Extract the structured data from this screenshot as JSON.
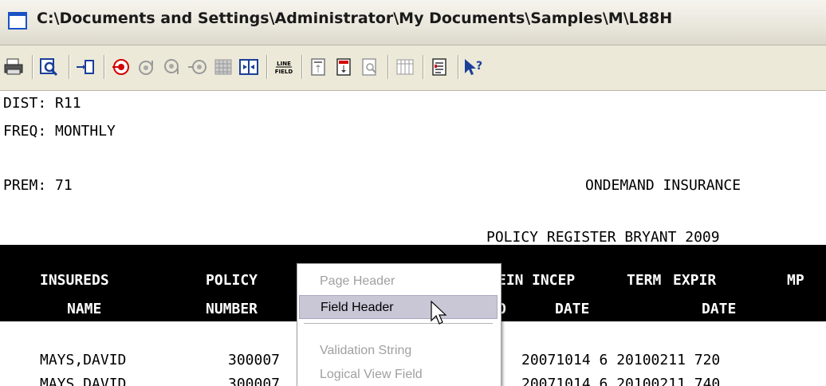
{
  "window": {
    "title": "C:\\Documents and Settings\\Administrator\\My Documents\\Samples\\M\\L88H"
  },
  "toolbar": {
    "icons": [
      "print-icon",
      "find-icon",
      "go-to-icon",
      "record-icon",
      "up-icon",
      "down-icon",
      "left-icon",
      "grid-icon",
      "split-icon",
      "line-field-icon",
      "header-icon",
      "page-header-icon",
      "preview-icon",
      "columns-icon",
      "list-icon",
      "help-icon"
    ],
    "line_field_text": [
      "LINE",
      "FIELD"
    ],
    "help_text": "?"
  },
  "report": {
    "dist": "DIST: R11",
    "freq": "FREQ: MONTHLY",
    "prem": "PREM: 71",
    "company": "ONDEMAND INSURANCE",
    "register": "POLICY REGISTER BRYANT 2009",
    "header1": {
      "insureds": "INSUREDS",
      "policy": "POLICY",
      "ein": "EIN",
      "incep": "INCEP",
      "term": "TERM",
      "expir": "EXPIR",
      "mp": "MP"
    },
    "header2": {
      "name": "NAME",
      "number": "NUMBER",
      "o": "O",
      "date": "DATE",
      "date2": "DATE"
    },
    "rows": [
      {
        "name": "MAYS,DAVID",
        "policy": "300007",
        "rest": "20071014 6 20100211 720"
      },
      {
        "name": "MAYS,DAVID",
        "policy": "300007",
        "rest": "20071014 6 20100211 740"
      }
    ]
  },
  "context_menu": {
    "items": [
      "Page Header",
      "Field Header",
      "Validation String",
      "Logical View Field"
    ]
  },
  "colors": {
    "accent": "#1a52c4",
    "highlight": "#c9c7d6",
    "record": "#d40000"
  }
}
